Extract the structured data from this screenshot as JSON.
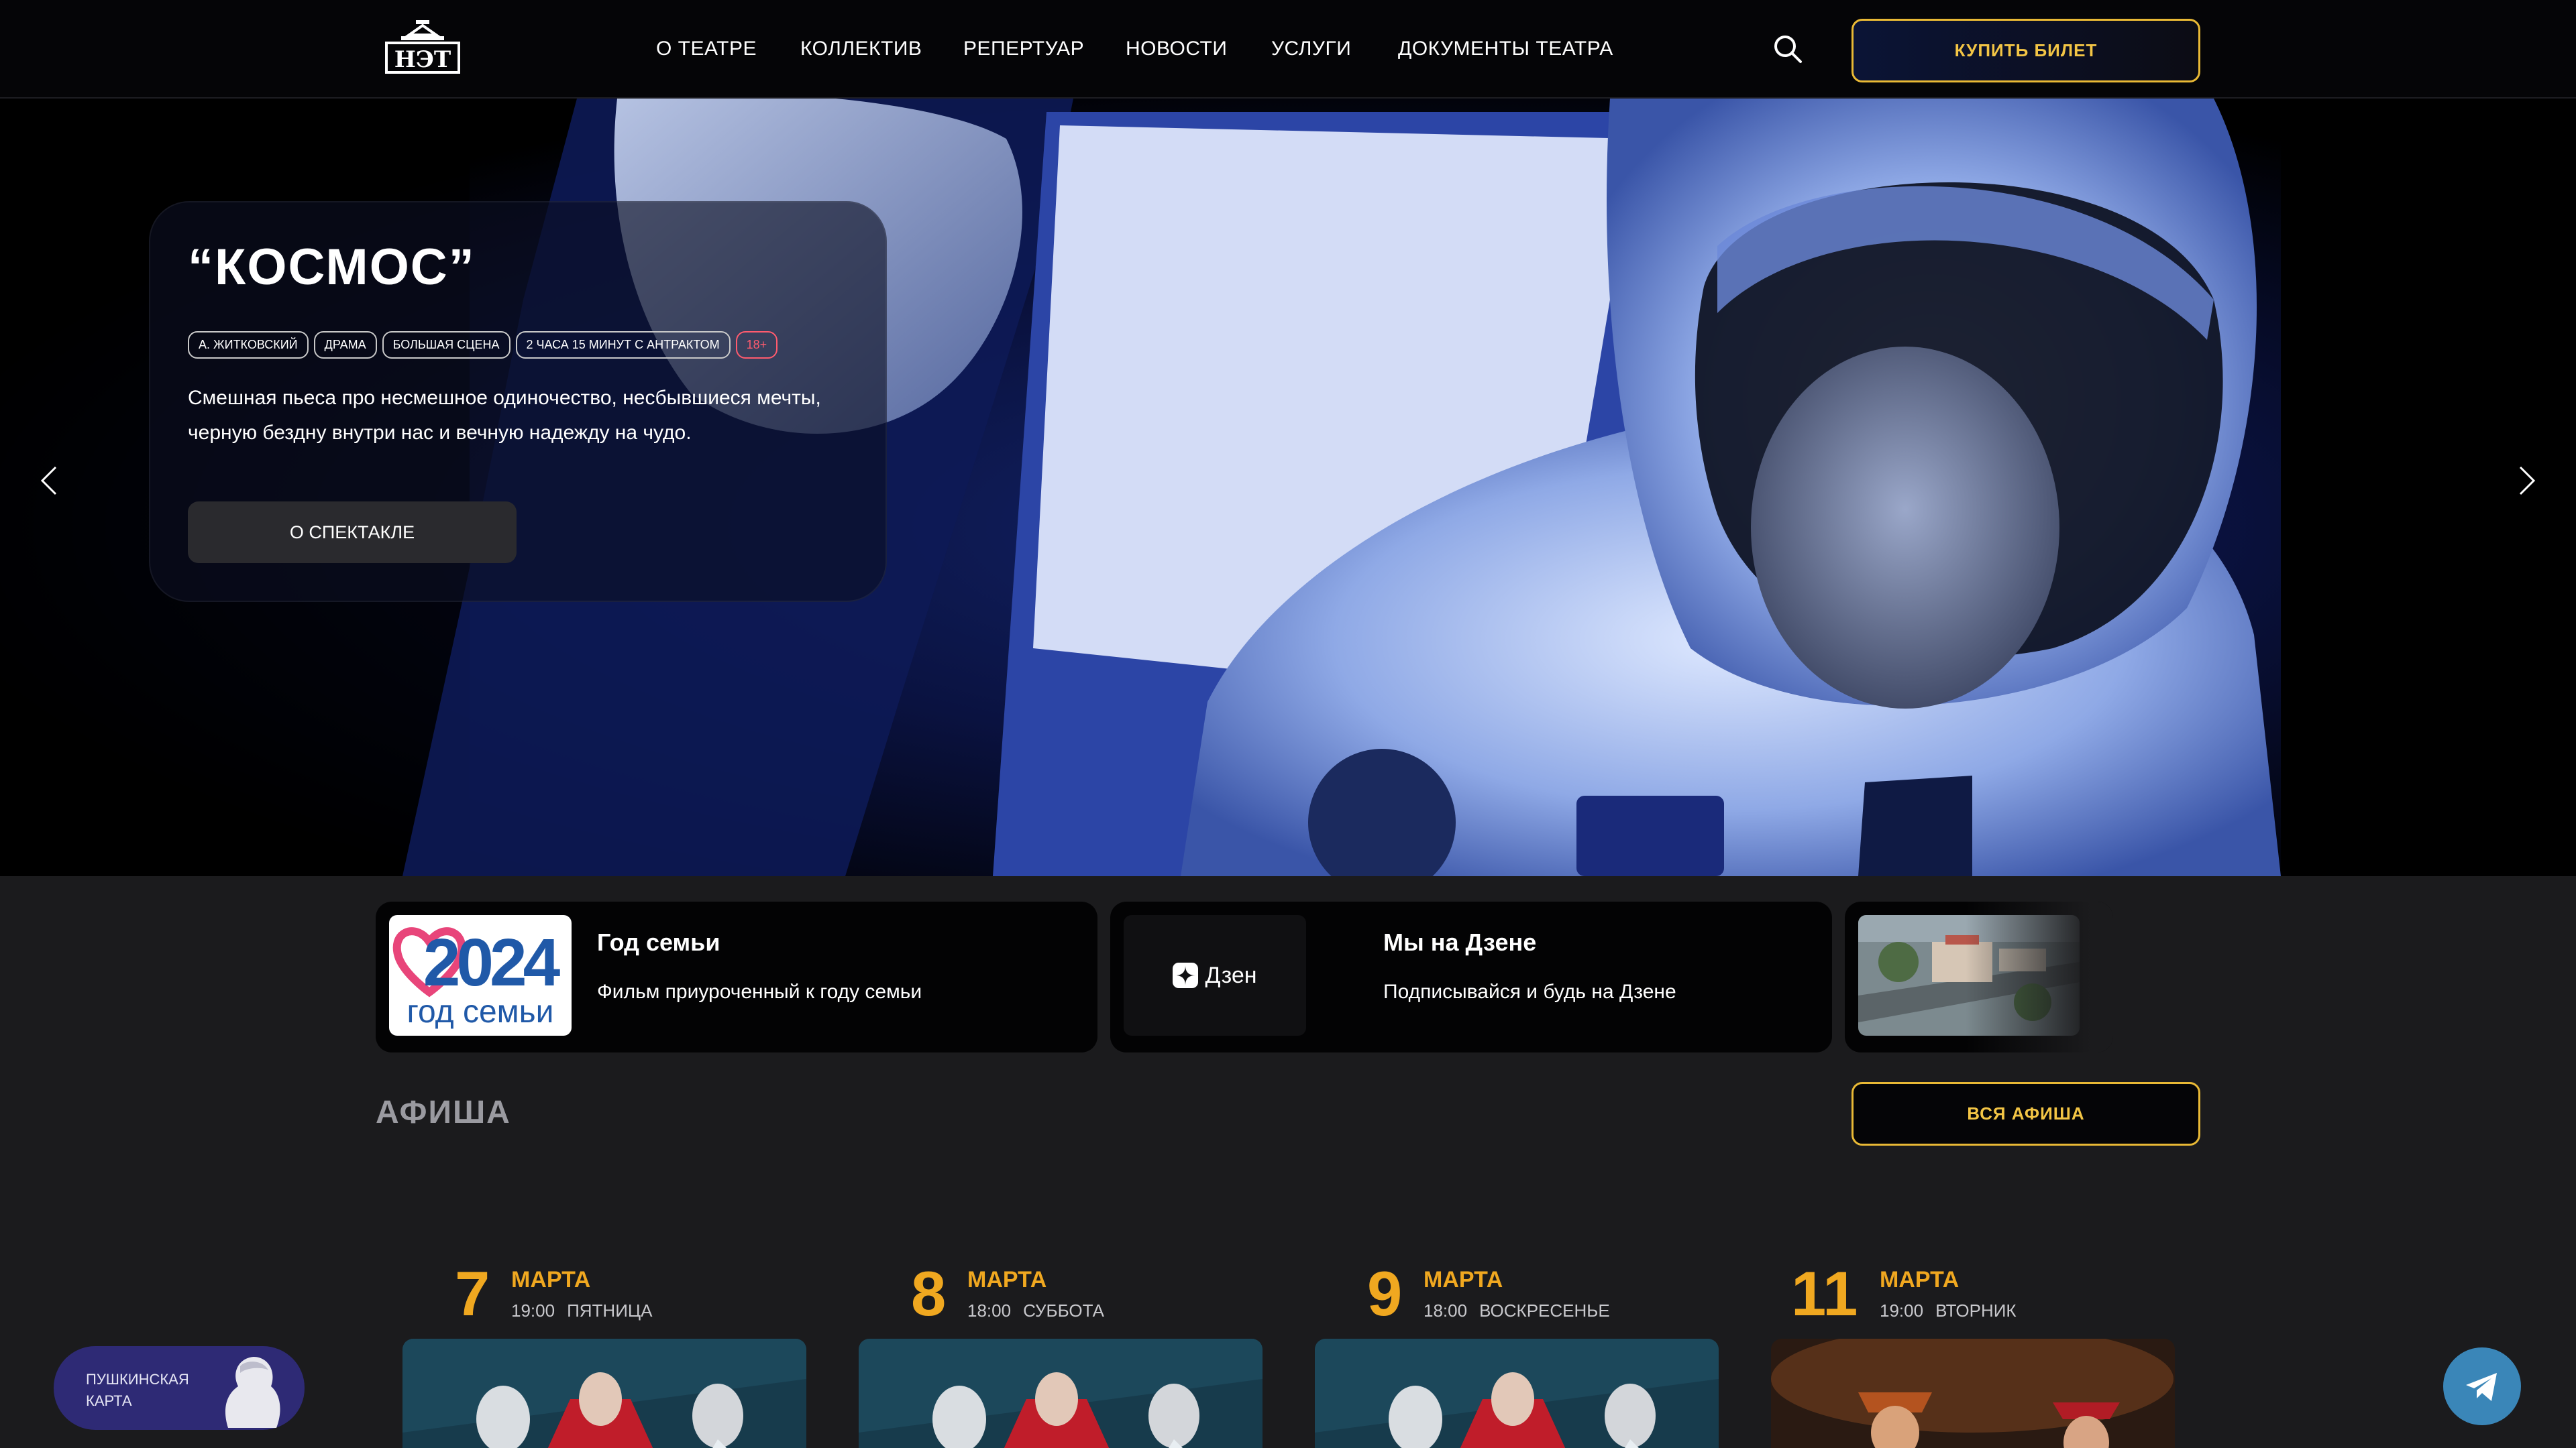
{
  "header": {
    "logo_text": "НЭТ",
    "nav": [
      {
        "label": "О ТЕАТРЕ"
      },
      {
        "label": "КОЛЛЕКТИВ"
      },
      {
        "label": "РЕПЕРТУАР"
      },
      {
        "label": "НОВОСТИ"
      },
      {
        "label": "УСЛУГИ"
      },
      {
        "label": "ДОКУМЕНТЫ ТЕАТРА"
      }
    ],
    "search_icon": "search-icon",
    "buy_label": "КУПИТЬ БИЛЕТ"
  },
  "hero": {
    "title": "“КОСМОС”",
    "tags": [
      "А. ЖИТКОВСКИЙ",
      "ДРАМА",
      "БОЛЬШАЯ СЦЕНА",
      "2 ЧАСА 15 МИНУТ С АНТРАКТОМ",
      "18+"
    ],
    "description": "Смешная пьеса про несмешное одиночество, несбывшиеся мечты, черную бездну внутри нас и вечную надежду на чудо.",
    "button_label": "О СПЕКТАКЛЕ",
    "prev_icon": "chevron-left-icon",
    "next_icon": "chevron-right-icon"
  },
  "promos": [
    {
      "badge_year": "2024",
      "badge_text": "год семьи",
      "title": "Год семьи",
      "text": "Фильм приуроченный к году семьи"
    },
    {
      "logo_text": "Дзен",
      "title": "Мы на Дзене",
      "text": "Подписывайся и будь на Дзене"
    },
    {
      "title": "",
      "text": ""
    }
  ],
  "afisha": {
    "title": "АФИША",
    "all_label": "ВСЯ АФИША",
    "events": [
      {
        "day": "7",
        "month": "МАРТА",
        "time": "19:00",
        "weekday": "ПЯТНИЦА"
      },
      {
        "day": "8",
        "month": "МАРТА",
        "time": "18:00",
        "weekday": "СУББОТА"
      },
      {
        "day": "9",
        "month": "МАРТА",
        "time": "18:00",
        "weekday": "ВОСКРЕСЕНЬЕ"
      },
      {
        "day": "11",
        "month": "МАРТА",
        "time": "19:00",
        "weekday": "ВТОРНИК"
      }
    ]
  },
  "widgets": {
    "pushkin_line1": "ПУШКИНСКАЯ",
    "pushkin_line2": "КАРТА",
    "telegram_icon": "telegram-icon"
  },
  "colors": {
    "accent": "#f0a820",
    "button_border": "#e9b935",
    "background": "#1b1b1d",
    "header": "#050507"
  }
}
